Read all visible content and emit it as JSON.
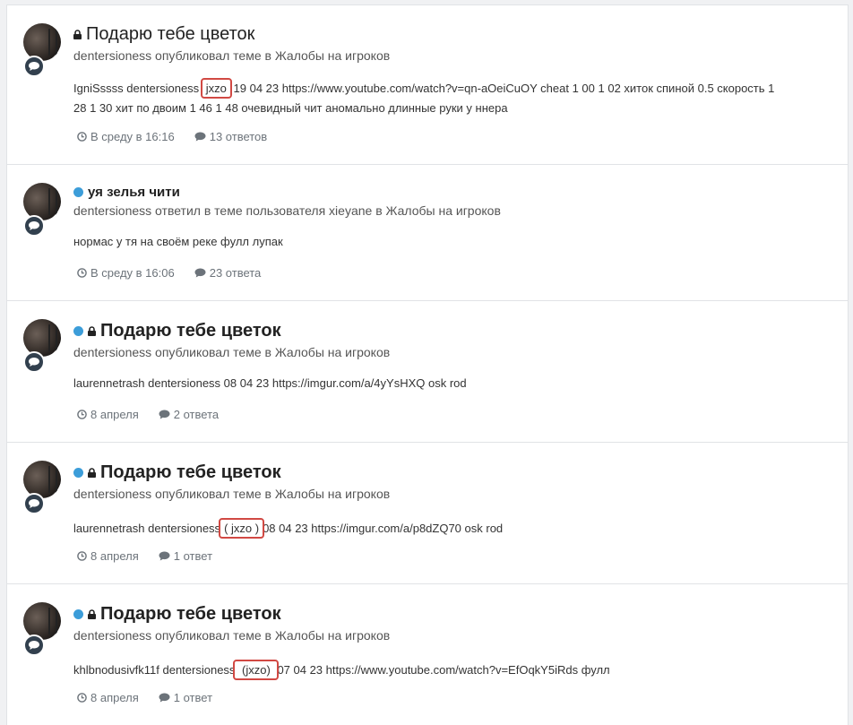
{
  "items": [
    {
      "title": "Подарю тебе цветок",
      "has_dot": false,
      "has_lock": true,
      "meta": "dentersioness опубликовал теме в Жалобы на игроков",
      "snippet_pre": "IgniSssss dentersioness ",
      "snippet_hl": "jxzo",
      "snippet_line1_rest": " 19 04 23 https://www.youtube.com/watch?v=qn-aOeiCuOY cheat 1 00 1 02 хиток спиной 0.5 скорость 1",
      "snippet_line2": "28 1 30 хит по двоим 1 46 1 48 очевидный чит аномально длинные руки у ннера",
      "date": "В среду в 16:16",
      "replies": "13 ответов"
    },
    {
      "title": "уя зелья чити",
      "has_dot": true,
      "has_lock": false,
      "meta": "dentersioness ответил в теме пользователя xieyane в Жалобы на игроков",
      "snippet": "нормас у тя на своём реке фулл лупак",
      "date": "В среду в 16:06",
      "replies": "23 ответа"
    },
    {
      "title": "Подарю тебе цветок",
      "has_dot": true,
      "has_lock": true,
      "meta": "dentersioness опубликовал теме в Жалобы на игроков",
      "snippet": "laurennetrash dentersioness 08 04 23 https://imgur.com/a/4yYsHXQ osk rod",
      "date": "8 апреля",
      "replies": "2 ответа"
    },
    {
      "title": "Подарю тебе цветок",
      "has_dot": true,
      "has_lock": true,
      "meta": "dentersioness опубликовал теме в Жалобы на игроков",
      "snippet_pre": "laurennetrash dentersioness",
      "snippet_hl": "( jxzo )",
      "snippet_post": "08 04 23 https://imgur.com/a/p8dZQ70 osk rod",
      "date": "8 апреля",
      "replies": "1 ответ"
    },
    {
      "title": "Подарю тебе цветок",
      "has_dot": true,
      "has_lock": true,
      "meta": "dentersioness опубликовал теме в Жалобы на игроков",
      "snippet_pre": "khlbnodusivfk11f dentersioness",
      "snippet_hl": " (jxzo) ",
      "snippet_post": "07 04 23 https://www.youtube.com/watch?v=EfOqkY5iRds фулл",
      "date": "8 апреля",
      "replies": "1 ответ"
    }
  ],
  "icons": {
    "lock": "lock-icon",
    "chat": "chat-bubble-icon",
    "clock": "clock-icon",
    "comment": "comment-icon"
  },
  "colors": {
    "unread_dot": "#3c9dd9",
    "badge": "#32404e",
    "highlight_box": "#d14943"
  }
}
